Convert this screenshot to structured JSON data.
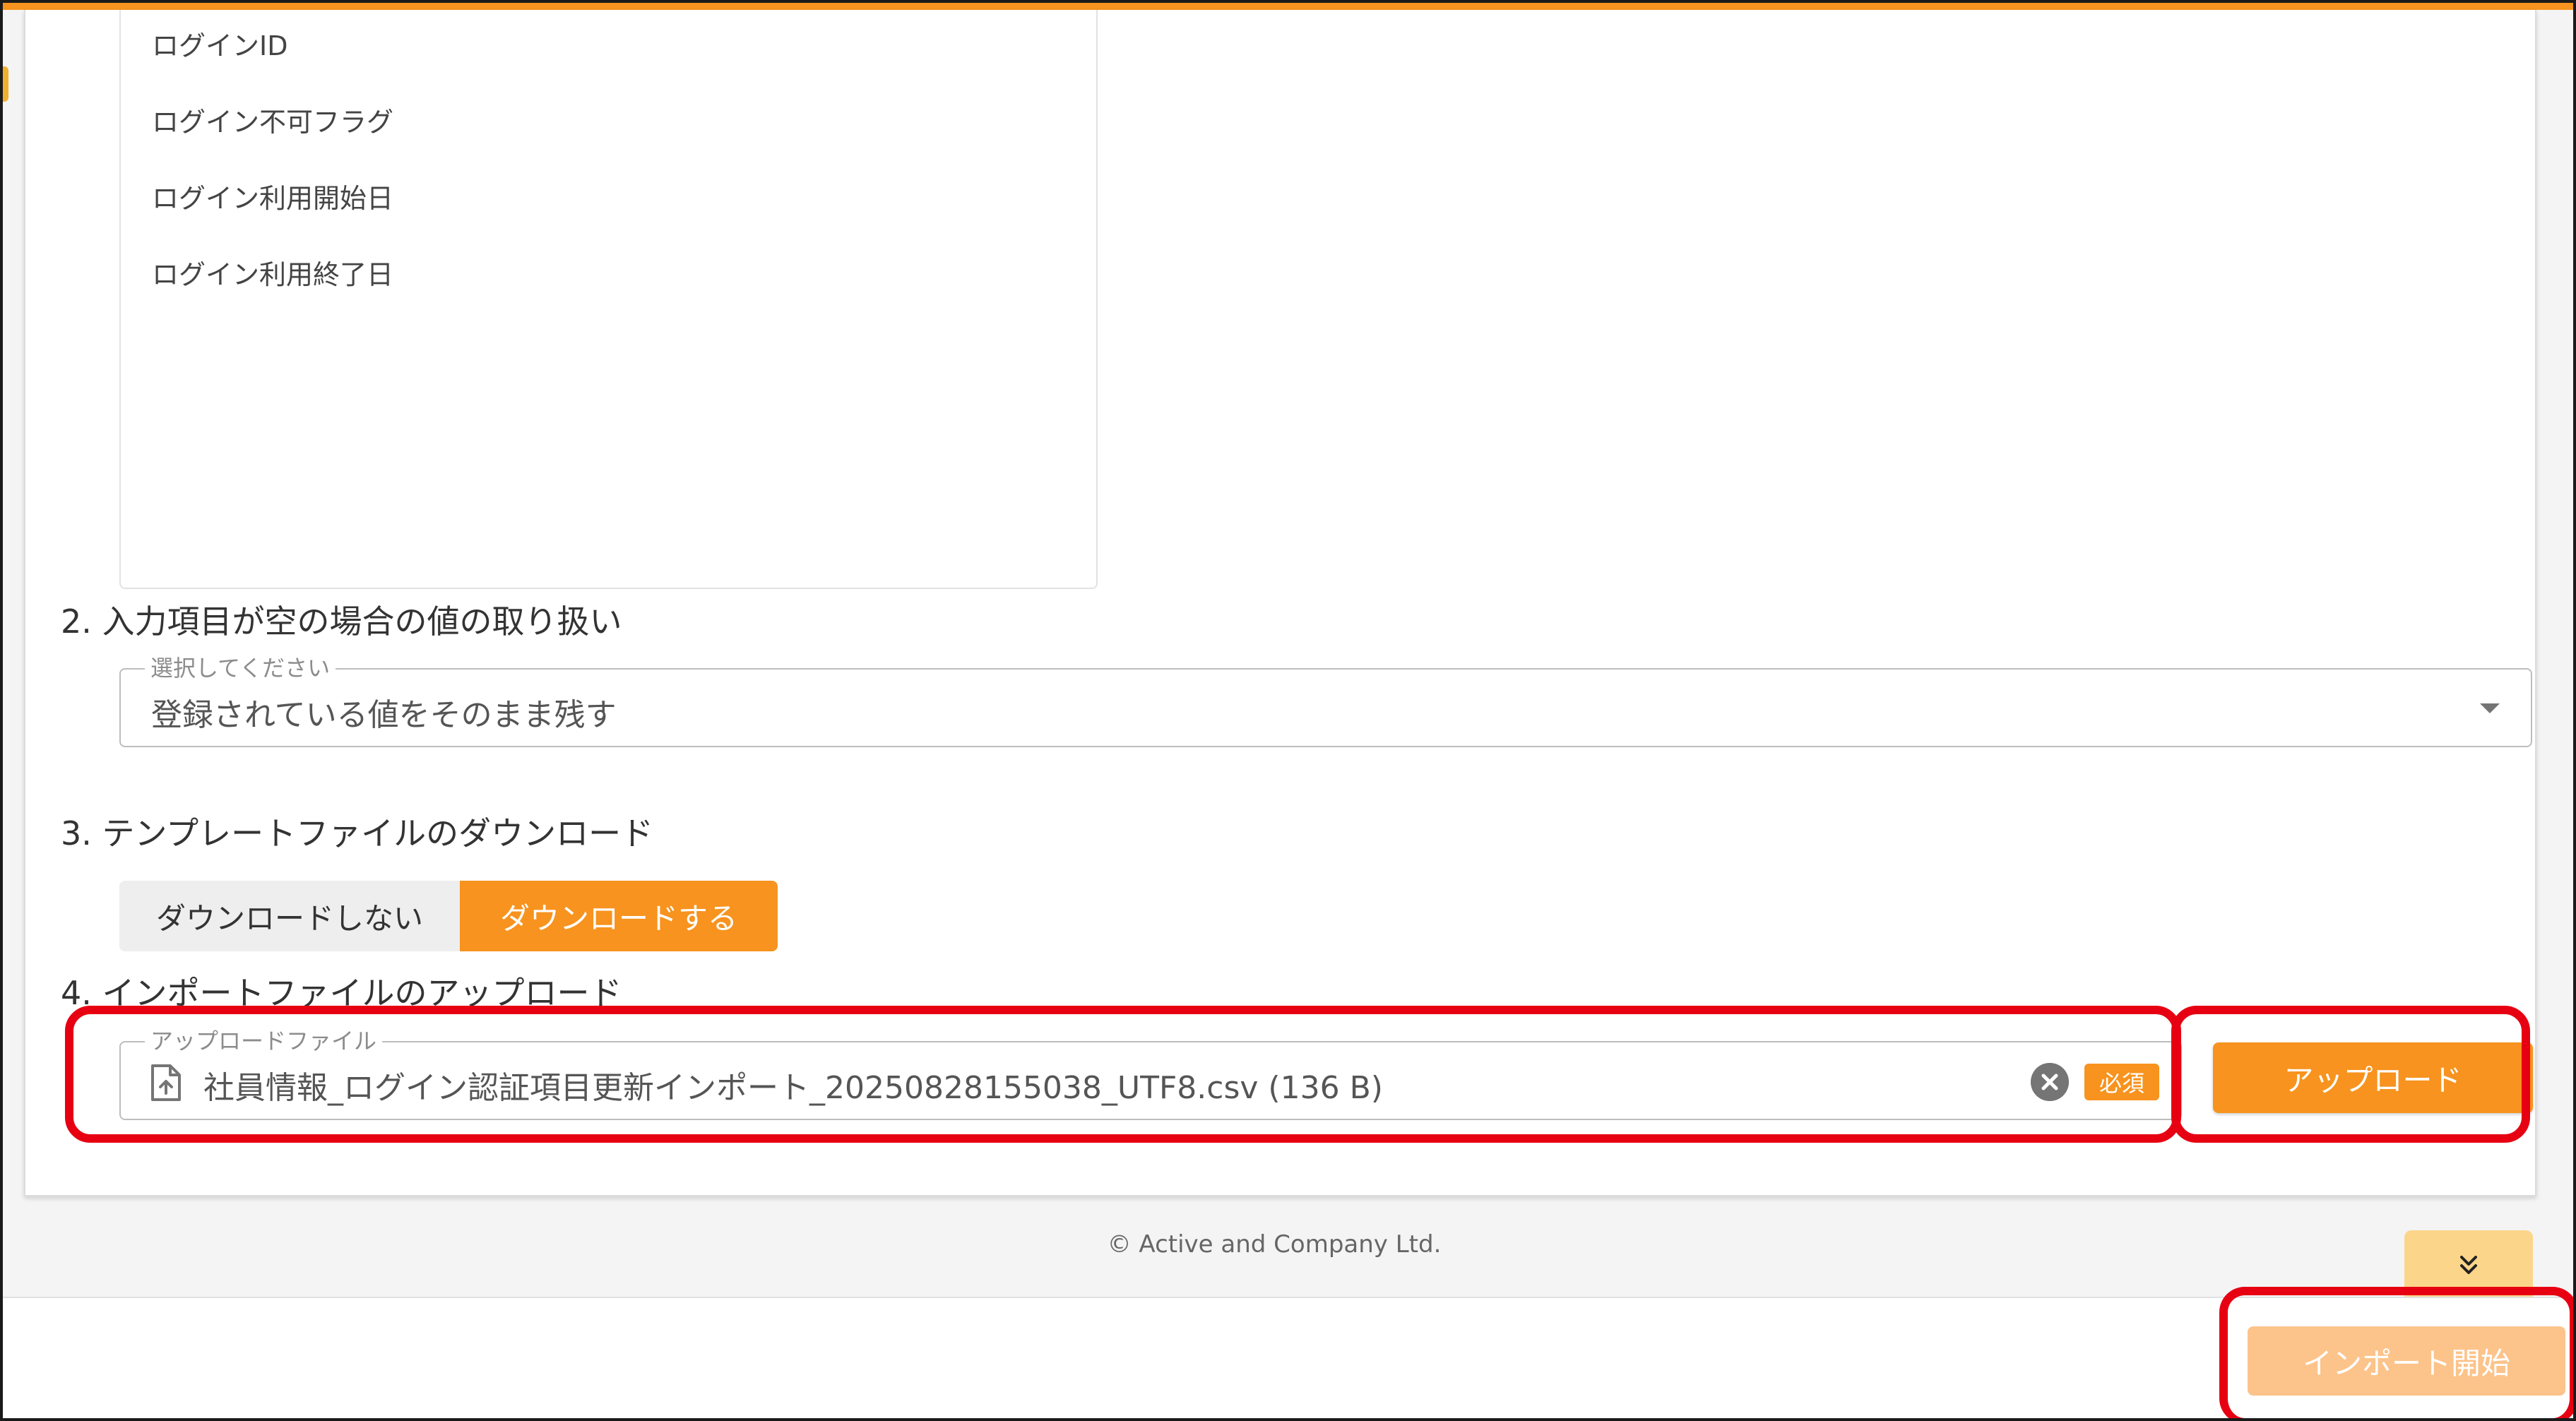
{
  "field_list": {
    "items": [
      "ログインID",
      "ログイン不可フラグ",
      "ログイン利用開始日",
      "ログイン利用終了日"
    ]
  },
  "section2": {
    "heading": "2. 入力項目が空の場合の値の取り扱い",
    "select_legend": "選択してください",
    "select_value": "登録されている値をそのまま残す"
  },
  "section3": {
    "heading": "3. テンプレートファイルのダウンロード",
    "option_no": "ダウンロードしない",
    "option_yes": "ダウンロードする"
  },
  "section4": {
    "heading": "4. インポートファイルのアップロード",
    "field_legend": "アップロードファイル",
    "file_name": "社員情報_ログイン認証項目更新インポート_20250828155038_UTF8.csv (136 B)",
    "required_label": "必須",
    "upload_button": "アップロード"
  },
  "footer": {
    "copyright": "© Active and Company Ltd.",
    "import_button": "インポート開始"
  },
  "colors": {
    "accent": "#f7931e",
    "accent_disabled": "#fcc38a",
    "highlight": "#e60012"
  },
  "icons": {
    "file": "file-upload-icon",
    "clear": "clear-circle-icon",
    "dropdown": "dropdown-arrow-icon",
    "scroll": "double-chevron-down-icon"
  }
}
